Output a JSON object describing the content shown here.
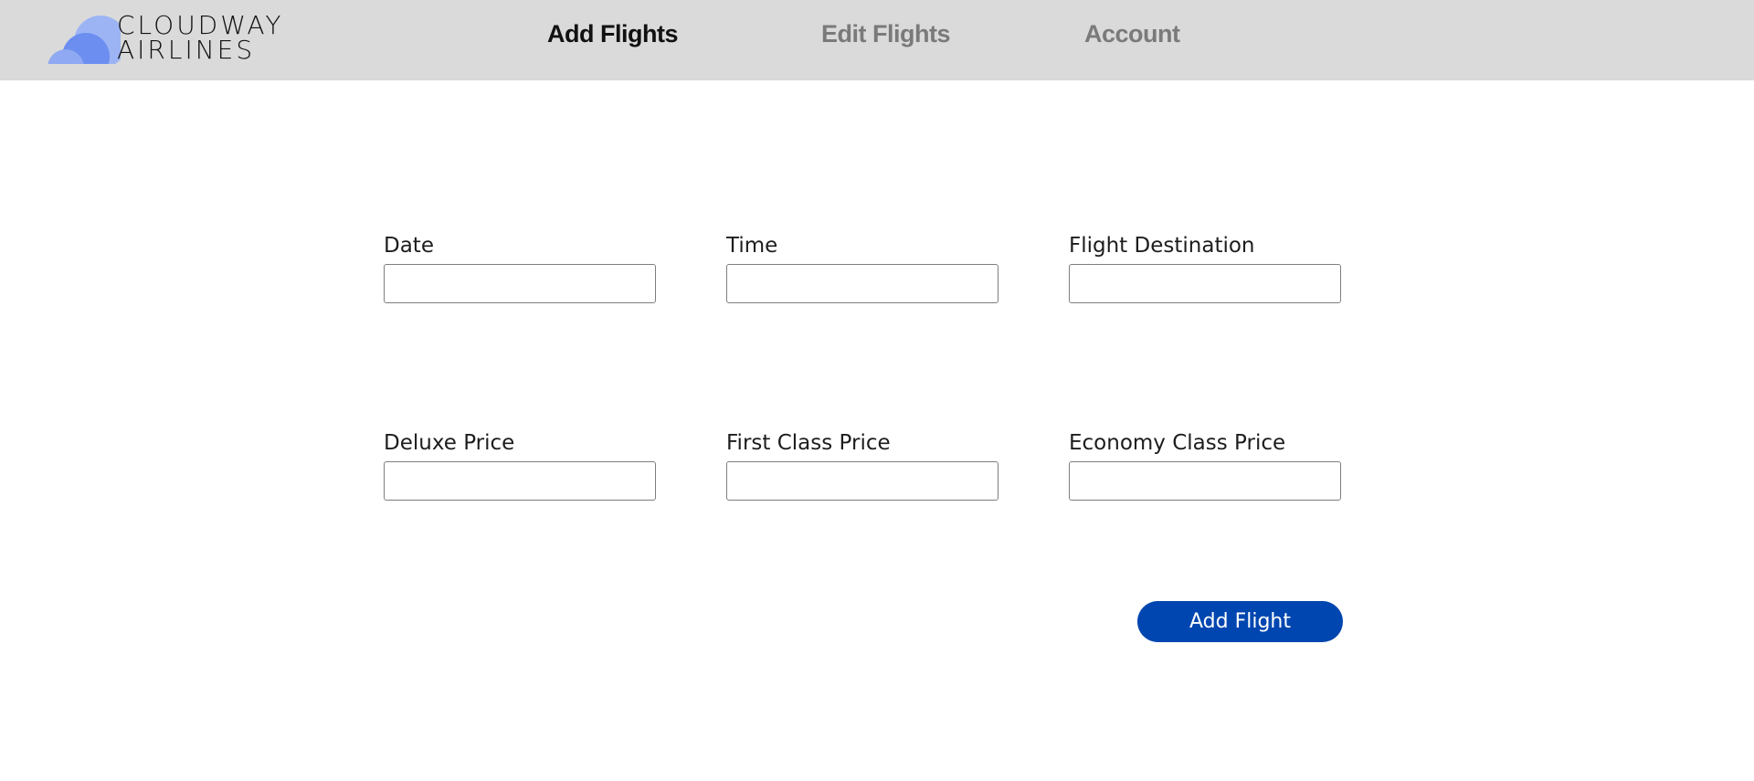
{
  "brand": {
    "name_line1": "CLOUDWAY",
    "name_line2": "AIRLINES",
    "logo_icon": "cloud-icon",
    "colors": {
      "cloud_light": "#8fa9f2",
      "cloud_mid": "#6b8ef0",
      "cloud_dark": "#4a6fe0"
    }
  },
  "nav": {
    "items": [
      {
        "label": "Add Flights",
        "active": true
      },
      {
        "label": "Edit Flights",
        "active": false
      },
      {
        "label": "Account",
        "active": false
      }
    ]
  },
  "form": {
    "fields": [
      {
        "label": "Date",
        "value": "",
        "placeholder": ""
      },
      {
        "label": "Time",
        "value": "",
        "placeholder": ""
      },
      {
        "label": "Flight Destination",
        "value": "",
        "placeholder": ""
      },
      {
        "label": "Deluxe Price",
        "value": "",
        "placeholder": ""
      },
      {
        "label": "First Class Price",
        "value": "",
        "placeholder": ""
      },
      {
        "label": "Economy Class Price",
        "value": "",
        "placeholder": ""
      }
    ],
    "submit_label": "Add Flight"
  },
  "colors": {
    "header_bg": "#dadada",
    "accent": "#0046b0",
    "nav_active": "#111111",
    "nav_inactive": "#7a7a7a"
  }
}
